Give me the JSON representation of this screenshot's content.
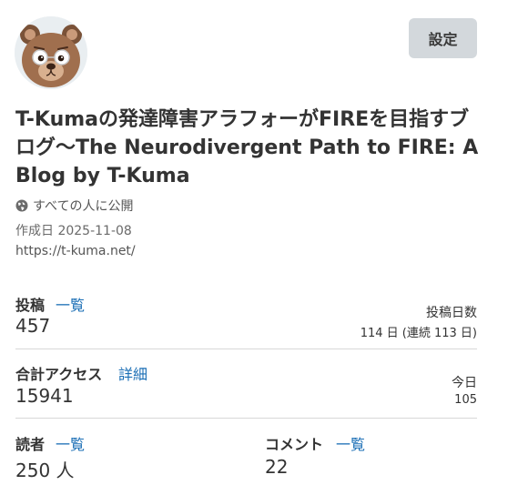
{
  "header": {
    "settings_label": "設定"
  },
  "blog": {
    "title": "T-Kumaの発達障害アラフォーがFIREを目指すブログ〜The Neurodivergent Path to FIRE: A Blog by T-Kuma",
    "visibility": "すべての人に公開",
    "created": "作成日 2025-11-08",
    "url": "https://t-kuma.net/"
  },
  "stats": {
    "posts": {
      "label": "投稿",
      "link": "一覧",
      "value": "457"
    },
    "post_days": {
      "label": "投稿日数",
      "value": "114 日 (連続 113 日)"
    },
    "access": {
      "label": "合計アクセス",
      "link": "詳細",
      "value": "15941"
    },
    "today": {
      "label": "今日",
      "value": "105"
    },
    "readers": {
      "label": "読者",
      "link": "一覧",
      "value": "250 人"
    },
    "comments": {
      "label": "コメント",
      "link": "一覧",
      "value": "22"
    }
  },
  "colors": {
    "link": "#1a6eb5",
    "button_bg": "#d3d8dc",
    "divider": "#d8d8d8"
  },
  "icons": {
    "visibility": "globe-icon",
    "avatar": "bear-avatar"
  }
}
